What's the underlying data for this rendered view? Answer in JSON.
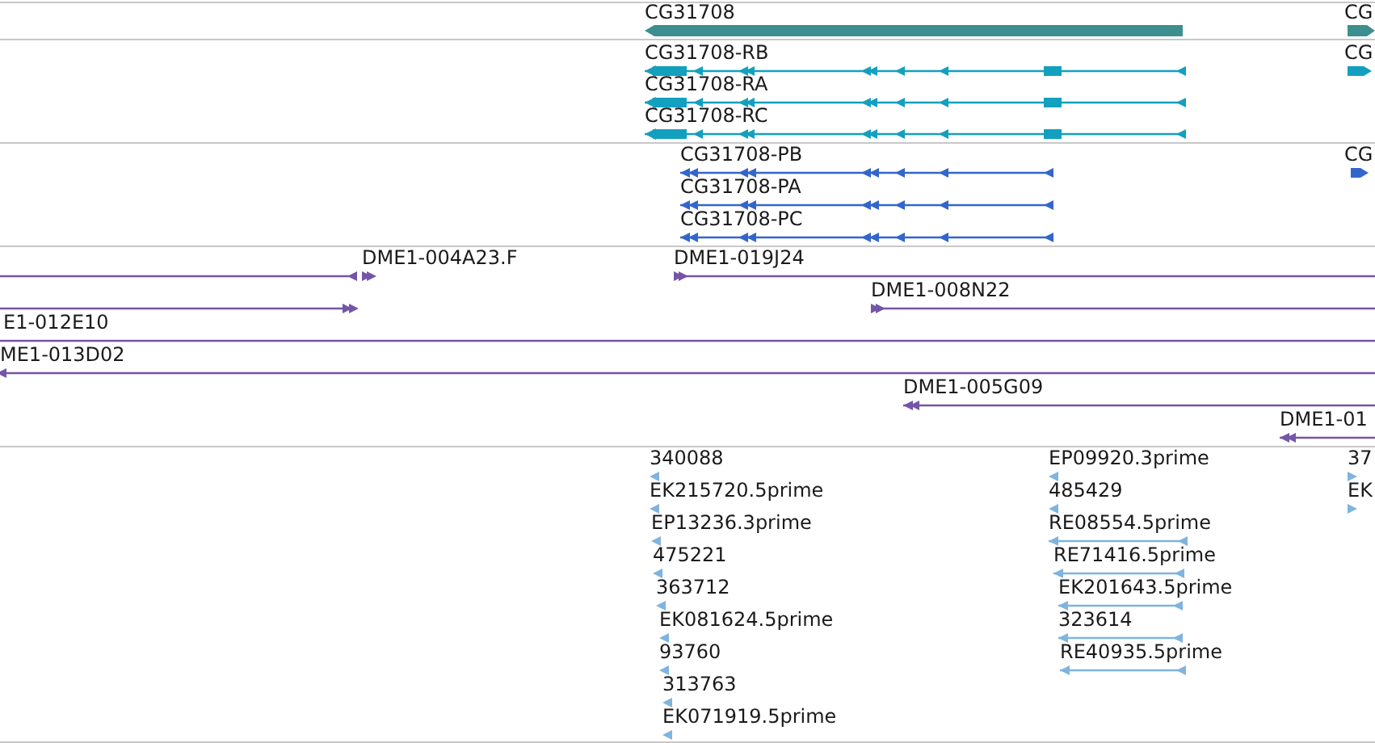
{
  "tracks": [
    {
      "color": "#3d8f8f",
      "features": [
        {
          "label": "CG31708",
          "kind": "reverse"
        },
        {
          "label": "CG",
          "kind": "forward"
        }
      ]
    },
    {
      "color": "#13a0bf",
      "features": [
        {
          "label": "CG31708-RB",
          "kind": "reverse"
        },
        {
          "label": "CG31708-RA",
          "kind": "reverse"
        },
        {
          "label": "CG31708-RC",
          "kind": "reverse"
        },
        {
          "label": "CG",
          "kind": "forward"
        }
      ]
    },
    {
      "color": "#3366cc",
      "features": [
        {
          "label": "CG31708-PB",
          "kind": "reverse"
        },
        {
          "label": "CG31708-PA",
          "kind": "reverse"
        },
        {
          "label": "CG31708-PC",
          "kind": "reverse"
        },
        {
          "label": "CG",
          "kind": "forward"
        }
      ]
    },
    {
      "color": "#7355a8",
      "features": [
        {
          "kind": "reverse"
        },
        {
          "label": "DME1-004A23.F",
          "kind": "forward"
        },
        {
          "label": "DME1-019J24",
          "kind": "forward"
        },
        {
          "kind": "forward"
        },
        {
          "label": "DME1-008N22",
          "kind": "forward"
        },
        {
          "label": "E1-012E10"
        },
        {
          "label": "ME1-013D02",
          "kind": "reverse"
        },
        {
          "label": "DME1-005G09",
          "kind": "reverse"
        },
        {
          "label": "DME1-01",
          "kind": "reverse"
        }
      ]
    },
    {
      "color": "#7fb4de",
      "features": [
        {
          "label": "340088",
          "kind": "reverse"
        },
        {
          "label": "EK215720.5prime",
          "kind": "reverse"
        },
        {
          "label": "EP13236.3prime",
          "kind": "reverse"
        },
        {
          "label": "475221",
          "kind": "reverse"
        },
        {
          "label": "363712",
          "kind": "reverse"
        },
        {
          "label": "EK081624.5prime",
          "kind": "reverse"
        },
        {
          "label": "93760",
          "kind": "reverse"
        },
        {
          "label": "313763",
          "kind": "reverse"
        },
        {
          "label": "EK071919.5prime",
          "kind": "reverse"
        },
        {
          "label": "EP09920.3prime",
          "kind": "reverse"
        },
        {
          "label": "485429",
          "kind": "reverse"
        },
        {
          "label": "RE08554.5prime",
          "kind": "reverse"
        },
        {
          "label": "RE71416.5prime",
          "kind": "reverse"
        },
        {
          "label": "EK201643.5prime",
          "kind": "reverse"
        },
        {
          "label": "323614",
          "kind": "reverse"
        },
        {
          "label": "RE40935.5prime",
          "kind": "reverse"
        },
        {
          "label": "37",
          "kind": "forward"
        },
        {
          "label": "EK",
          "kind": "forward"
        }
      ]
    }
  ]
}
